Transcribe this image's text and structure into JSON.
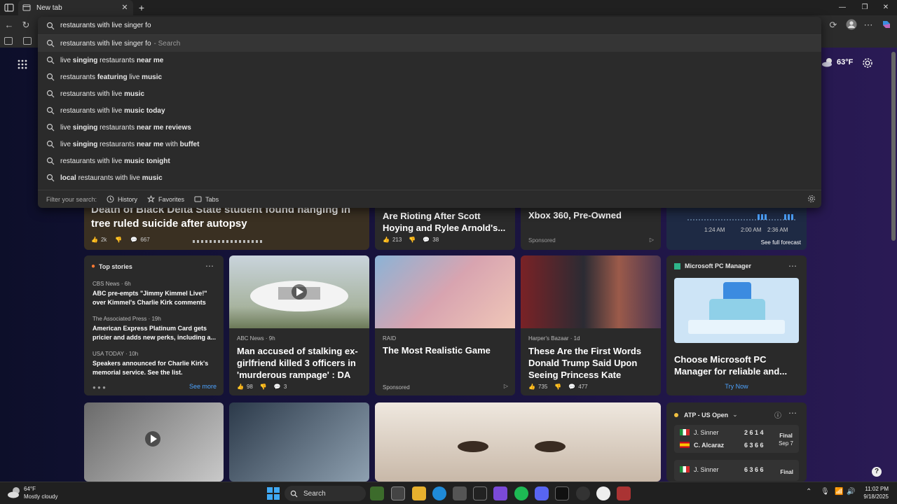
{
  "tabs": [
    {
      "title": "New tab"
    }
  ],
  "omnibox": {
    "query": "restaurants with live singer fo",
    "suggestions": [
      {
        "plain1": "restaurants with live singer fo",
        "bold1": "",
        "plain2": "",
        "bold2": "",
        "hint": "- Search"
      },
      {
        "plain1": "live ",
        "bold1": "singing",
        "plain2": " restaurants ",
        "bold2": "near me",
        "hint": ""
      },
      {
        "plain1": "restaurants ",
        "bold1": "featuring",
        "plain2": " live ",
        "bold2": "music",
        "hint": ""
      },
      {
        "plain1": "restaurants with live ",
        "bold1": "music",
        "plain2": "",
        "bold2": "",
        "hint": ""
      },
      {
        "plain1": "restaurants with live ",
        "bold1": "music today",
        "plain2": "",
        "bold2": "",
        "hint": ""
      },
      {
        "plain1": "live ",
        "bold1": "singing",
        "plain2": " restaurants ",
        "bold2": "near me reviews",
        "hint": ""
      },
      {
        "plain1": "live ",
        "bold1": "singing",
        "plain2": " restaurants ",
        "bold2": "near me",
        "plain3": " with ",
        "bold3": "buffet",
        "hint": ""
      },
      {
        "plain1": "restaurants with live ",
        "bold1": "music tonight",
        "plain2": "",
        "bold2": "",
        "hint": ""
      },
      {
        "plain1": "",
        "bold1": "local",
        "plain2": " restaurants with live ",
        "bold2": "music",
        "hint": ""
      }
    ],
    "filter_label": "Filter your search:",
    "filters": [
      "History",
      "Favorites",
      "Tabs"
    ]
  },
  "weather_top": {
    "temp": "63°F"
  },
  "feed": {
    "hero": {
      "title_line1": "Death of Black Delta State student found hanging in",
      "title_line2": "tree ruled suicide after autopsy",
      "likes": "2k",
      "comments": "667"
    },
    "card2": {
      "title": "Are Rioting After Scott Hoying and Rylee Arnold's...",
      "likes": "213",
      "comments": "38"
    },
    "card3": {
      "title": "Xbox 360, Pre-Owned",
      "sponsored": "Sponsored"
    },
    "forecast": {
      "times": [
        "1:24 AM",
        "2:00 AM",
        "2:36 AM"
      ],
      "link": "See full forecast"
    },
    "top_stories": {
      "header": "Top stories",
      "items": [
        {
          "source": "CBS News · 6h",
          "text": "ABC pre-empts \"Jimmy Kimmel Live!\" over Kimmel's Charlie Kirk comments"
        },
        {
          "source": "The Associated Press · 19h",
          "text": "American Express Platinum Card gets pricier and adds new perks, including a..."
        },
        {
          "source": "USA TODAY · 10h",
          "text": "Speakers announced for Charlie Kirk's memorial service. See the list."
        }
      ],
      "see_more": "See more"
    },
    "card_abc": {
      "source": "ABC News · 9h",
      "title": "Man accused of stalking ex-girlfriend killed 3 officers in 'murderous rampage' : DA",
      "likes": "98",
      "comments": "3"
    },
    "card_raid": {
      "source": "RAID",
      "title": "The Most Realistic Game",
      "sponsored": "Sponsored"
    },
    "card_harper": {
      "source": "Harper's Bazaar · 1d",
      "title": "These Are the First Words Donald Trump Said Upon Seeing Princess Kate",
      "likes": "735",
      "comments": "477"
    },
    "pcmanager": {
      "header": "Microsoft PC Manager",
      "title": "Choose Microsoft PC Manager for reliable and...",
      "cta": "Try Now"
    },
    "atp": {
      "header": "ATP - US Open",
      "match1": {
        "p1": "J. Sinner",
        "s1": "2 6 1 4",
        "p2": "C. Alcaraz",
        "s2": "6 3 6 6",
        "status": "Final",
        "date": "Sep 7"
      },
      "match2": {
        "p1": "J. Sinner",
        "s1": "6 3 6 6",
        "status": "Final"
      }
    }
  },
  "taskbar": {
    "weather": {
      "temp": "64°F",
      "desc": "Mostly cloudy"
    },
    "search": "Search",
    "time": "11:02 PM",
    "date": "9/18/2025"
  },
  "colors": {
    "accent": "#4da3ff",
    "sponsor": "#9a9a9a"
  }
}
